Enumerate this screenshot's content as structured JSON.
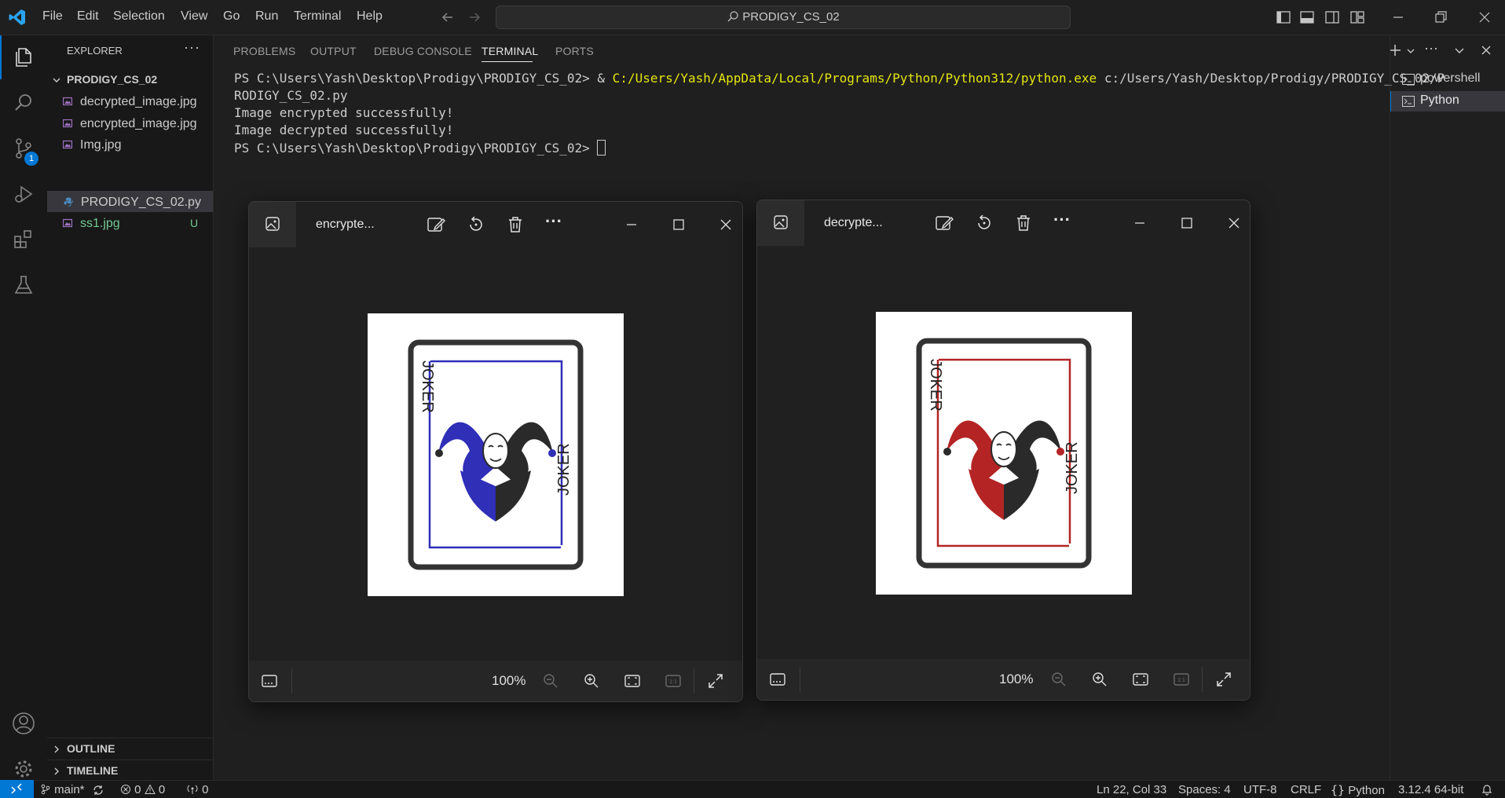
{
  "menu": {
    "file": "File",
    "edit": "Edit",
    "selection": "Selection",
    "view": "View",
    "go": "Go",
    "run": "Run",
    "terminal": "Terminal",
    "help": "Help"
  },
  "command_center": {
    "text": "PRODIGY_CS_02"
  },
  "activity": {
    "scm_badge": "1"
  },
  "explorer": {
    "title": "EXPLORER",
    "folder": "PRODIGY_CS_02",
    "files": [
      {
        "name": "decrypted_image.jpg",
        "color": "#cccccc",
        "badge": ""
      },
      {
        "name": "encrypted_image.jpg",
        "color": "#cccccc",
        "badge": ""
      },
      {
        "name": "Img.jpg",
        "color": "#cccccc",
        "badge": ""
      },
      {
        "name": "PRODIGY_CS_02.py",
        "color": "#cccccc",
        "badge": ""
      },
      {
        "name": "ss1.jpg",
        "color": "#73c991",
        "badge": "U"
      }
    ],
    "outline": "OUTLINE",
    "timeline": "TIMELINE"
  },
  "panel": {
    "tabs": [
      "PROBLEMS",
      "OUTPUT",
      "DEBUG CONSOLE",
      "TERMINAL",
      "PORTS"
    ],
    "active": "TERMINAL"
  },
  "terminal": {
    "prompt": "PS C:\\Users\\Yash\\Desktop\\Prodigy\\PRODIGY_CS_02>",
    "amp": "&",
    "exe": "C:/Users/Yash/AppData/Local/Programs/Python/Python312/python.exe",
    "script_part1": "c:/Users/Yash/Desktop/Prodigy/PRODIGY_CS_02/P",
    "script_part2": "RODIGY_CS_02.py",
    "out1": "Image encrypted successfully!",
    "out2": "Image decrypted successfully!",
    "prompt2": "PS C:\\Users\\Yash\\Desktop\\Prodigy\\PRODIGY_CS_02>"
  },
  "terminal_list": [
    {
      "name": "powershell"
    },
    {
      "name": "Python"
    }
  ],
  "photos": [
    {
      "title": "encrypte...",
      "zoom": "100%",
      "card_word": "JOKER",
      "accent": "#2f2fb8"
    },
    {
      "title": "decrypte...",
      "zoom": "100%",
      "card_word": "JOKER",
      "accent": "#b42424"
    }
  ],
  "status": {
    "branch": "main*",
    "errors": "0",
    "warnings": "0",
    "ports": "0",
    "position": "Ln 22, Col 33",
    "spaces": "Spaces: 4",
    "encoding": "UTF-8",
    "eol": "CRLF",
    "language": "Python",
    "interpreter": "3.12.4 64-bit"
  }
}
